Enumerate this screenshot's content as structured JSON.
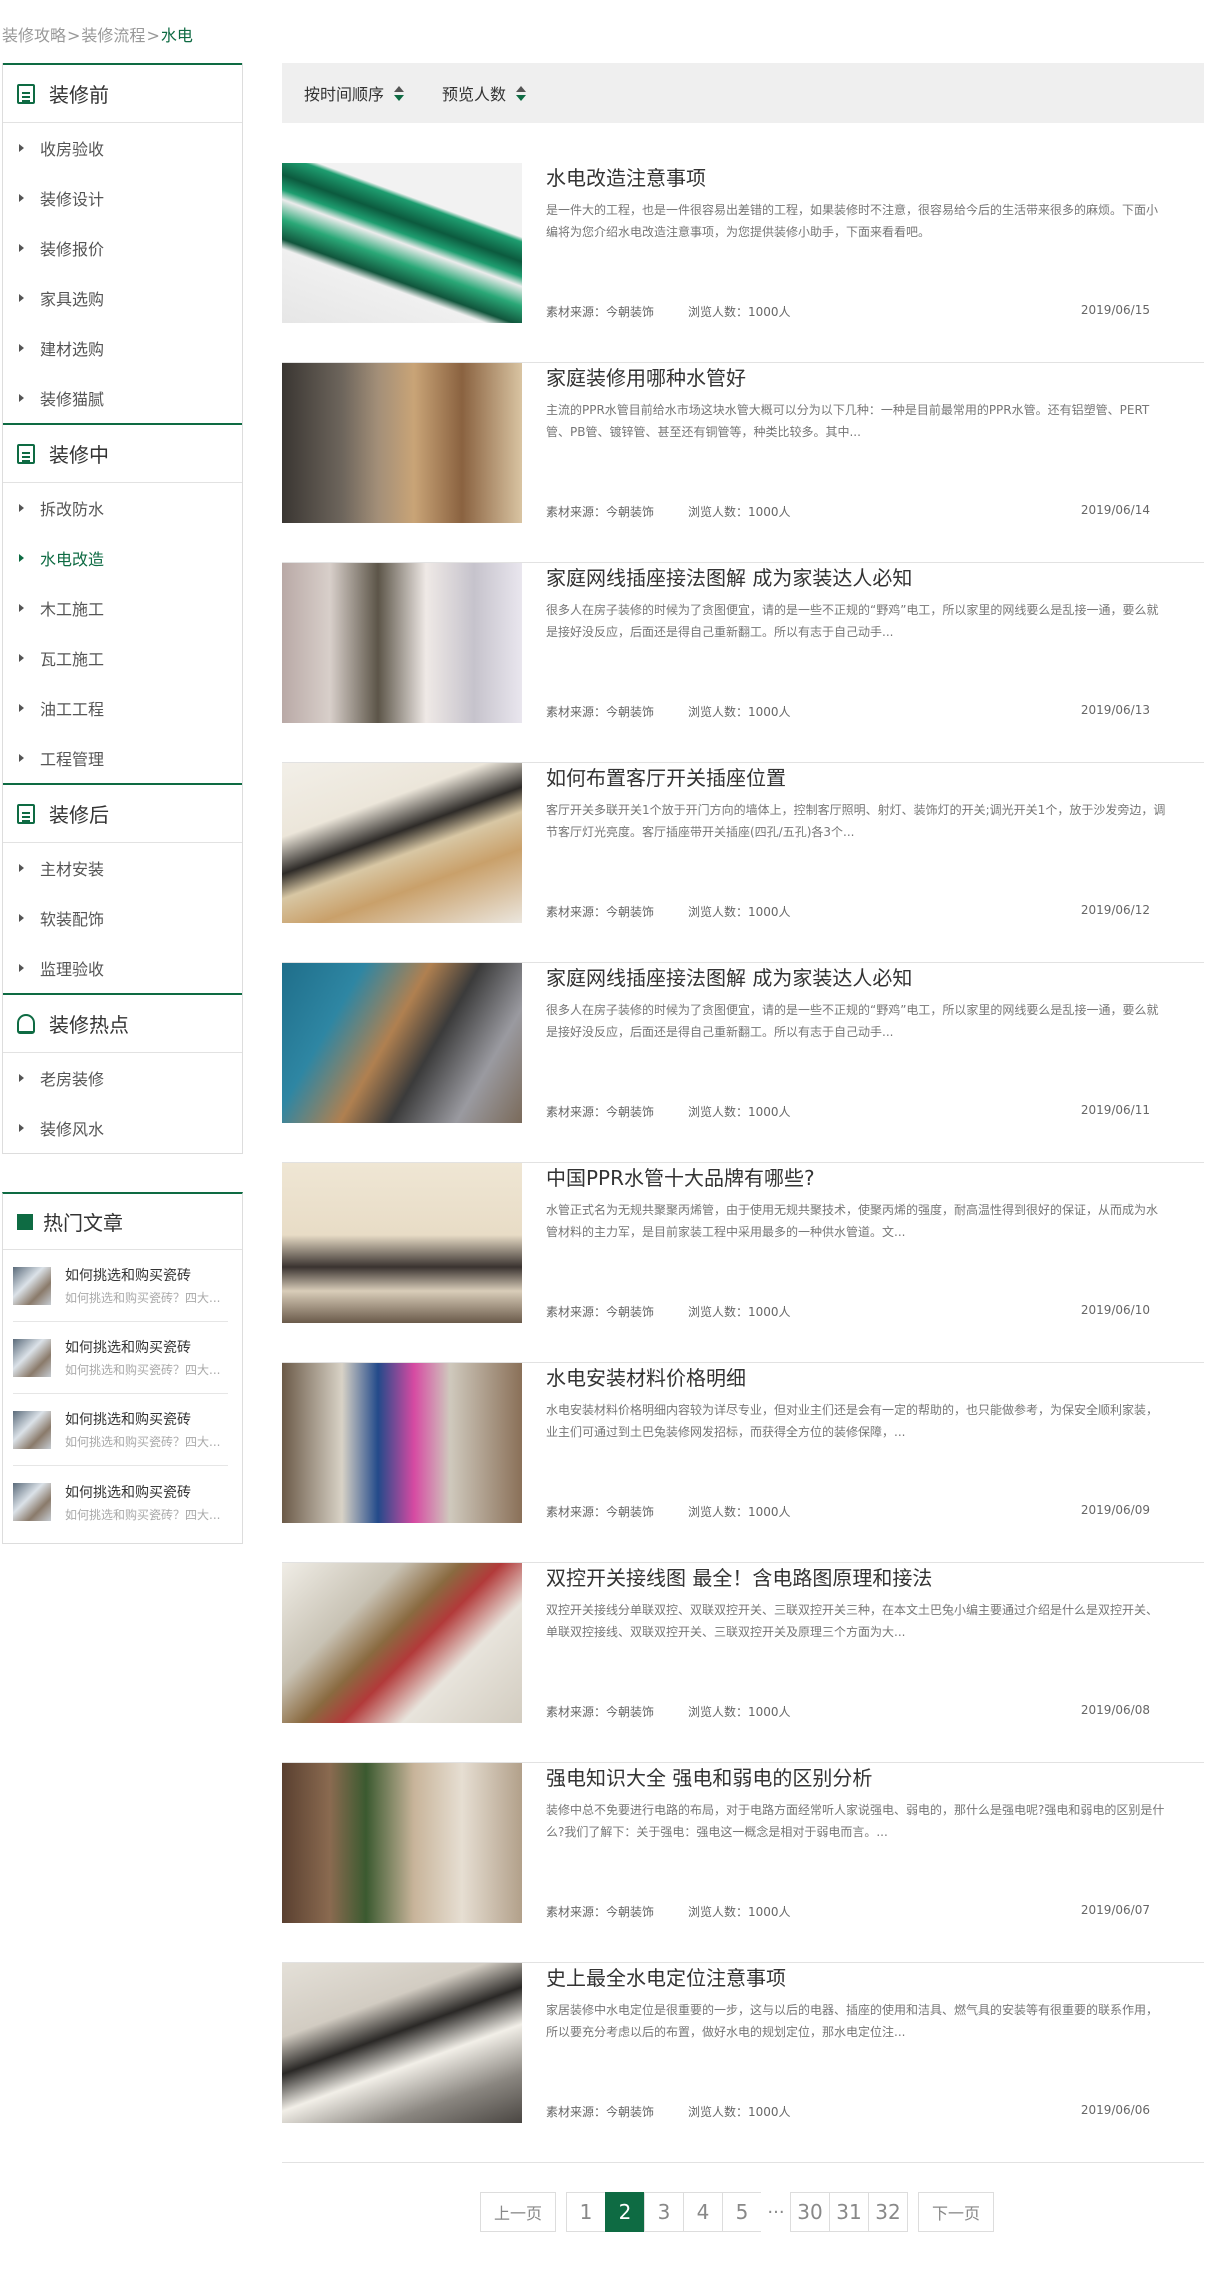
{
  "breadcrumb": {
    "items": [
      "装修攻略",
      "装修流程"
    ],
    "sep": ">",
    "current": "水电"
  },
  "sidebar": {
    "categories": [
      {
        "title": "装修前",
        "icon": "document-icon",
        "items": [
          "收房验收",
          "装修设计",
          "装修报价",
          "家具选购",
          "建材选购",
          "装修猫腻"
        ]
      },
      {
        "title": "装修中",
        "icon": "document-icon",
        "items": [
          "拆改防水",
          "水电改造",
          "木工施工",
          "瓦工施工",
          "油工工程",
          "工程管理"
        ],
        "active": "水电改造"
      },
      {
        "title": "装修后",
        "icon": "document-icon",
        "items": [
          "主材安装",
          "软装配饰",
          "监理验收"
        ]
      },
      {
        "title": "装修热点",
        "icon": "bell-icon",
        "items": [
          "老房装修",
          "装修风水"
        ]
      }
    ],
    "hot": {
      "title": "热门文章",
      "items": [
        {
          "title": "如何挑选和购买瓷砖",
          "desc": "如何挑选和购买瓷砖？四大..."
        },
        {
          "title": "如何挑选和购买瓷砖",
          "desc": "如何挑选和购买瓷砖？四大..."
        },
        {
          "title": "如何挑选和购买瓷砖",
          "desc": "如何挑选和购买瓷砖？四大..."
        },
        {
          "title": "如何挑选和购买瓷砖",
          "desc": "如何挑选和购买瓷砖？四大..."
        }
      ]
    }
  },
  "sort": {
    "by_time": "按时间顺序",
    "by_views": "预览人数"
  },
  "articles": [
    {
      "title": "水电改造注意事项",
      "desc": "是一件大的工程，也是一件很容易出差错的工程，如果装修时不注意，很容易给今后的生活带来很多的麻烦。下面小编将为您介绍水电改造注意事项，为您提供装修小助手，下面来看看吧。",
      "source": "素材来源：今朝装饰",
      "views": "浏览人数：1000人",
      "date": "2019/06/15"
    },
    {
      "title": "家庭装修用哪种水管好",
      "desc": "主流的PPR水管目前给水市场这块水管大概可以分为以下几种：一种是目前最常用的PPR水管。还有铝塑管、PERT管、PB管、镀锌管、甚至还有铜管等，种类比较多。其中...",
      "source": "素材来源：今朝装饰",
      "views": "浏览人数：1000人",
      "date": "2019/06/14"
    },
    {
      "title": "家庭网线插座接法图解 成为家装达人必知",
      "desc": "很多人在房子装修的时候为了贪图便宜，请的是一些不正规的“野鸡”电工，所以家里的网线要么是乱接一通，要么就是接好没反应，后面还是得自己重新翻工。所以有志于自己动手...",
      "source": "素材来源：今朝装饰",
      "views": "浏览人数：1000人",
      "date": "2019/06/13"
    },
    {
      "title": "如何布置客厅开关插座位置",
      "desc": "客厅开关多联开关1个放于开门方向的墙体上，控制客厅照明、射灯、装饰灯的开关;调光开关1个，放于沙发旁边，调节客厅灯光亮度。客厅插座带开关插座(四孔/五孔)各3个...",
      "source": "素材来源：今朝装饰",
      "views": "浏览人数：1000人",
      "date": "2019/06/12"
    },
    {
      "title": "家庭网线插座接法图解 成为家装达人必知",
      "desc": "很多人在房子装修的时候为了贪图便宜，请的是一些不正规的“野鸡”电工，所以家里的网线要么是乱接一通，要么就是接好没反应，后面还是得自己重新翻工。所以有志于自己动手...",
      "source": "素材来源：今朝装饰",
      "views": "浏览人数：1000人",
      "date": "2019/06/11"
    },
    {
      "title": "中国PPR水管十大品牌有哪些?",
      "desc": "水管正式名为无规共聚聚丙烯管，由于使用无规共聚技术，使聚丙烯的强度，耐高温性得到很好的保证，从而成为水管材料的主力军，是目前家装工程中采用最多的一种供水管道。文...",
      "source": "素材来源：今朝装饰",
      "views": "浏览人数：1000人",
      "date": "2019/06/10"
    },
    {
      "title": "水电安装材料价格明细",
      "desc": "水电安装材料价格明细内容较为详尽专业，但对业主们还是会有一定的帮助的，也只能做参考，为保安全顺利家装，业主们可通过到土巴兔装修网发招标，而获得全方位的装修保障，...",
      "source": "素材来源：今朝装饰",
      "views": "浏览人数：1000人",
      "date": "2019/06/09"
    },
    {
      "title": "双控开关接线图 最全！含电路图原理和接法",
      "desc": "双控开关接线分单联双控、双联双控开关、三联双控开关三种，在本文土巴兔小编主要通过介绍是什么是双控开关、单联双控接线、双联双控开关、三联双控开关及原理三个方面为大...",
      "source": "素材来源：今朝装饰",
      "views": "浏览人数：1000人",
      "date": "2019/06/08"
    },
    {
      "title": "强电知识大全 强电和弱电的区别分析",
      "desc": "装修中总不免要进行电路的布局，对于电路方面经常听人家说强电、弱电的，那什么是强电呢?强电和弱电的区别是什么?我们了解下：关于强电：强电这一概念是相对于弱电而言。...",
      "source": "素材来源：今朝装饰",
      "views": "浏览人数：1000人",
      "date": "2019/06/07"
    },
    {
      "title": "史上最全水电定位注意事项",
      "desc": "家居装修中水电定位是很重要的一步，这与以后的电器、插座的使用和洁具、燃气具的安装等有很重要的联系作用，所以要充分考虑以后的布置，做好水电的规划定位，那水电定位注...",
      "source": "素材来源：今朝装饰",
      "views": "浏览人数：1000人",
      "date": "2019/06/06"
    }
  ],
  "pagination": {
    "prev": "上一页",
    "pages": [
      "1",
      "2",
      "3",
      "4",
      "5"
    ],
    "current": "2",
    "ellipsis": "···",
    "last_pages": [
      "30",
      "31",
      "32"
    ],
    "next": "下一页"
  }
}
